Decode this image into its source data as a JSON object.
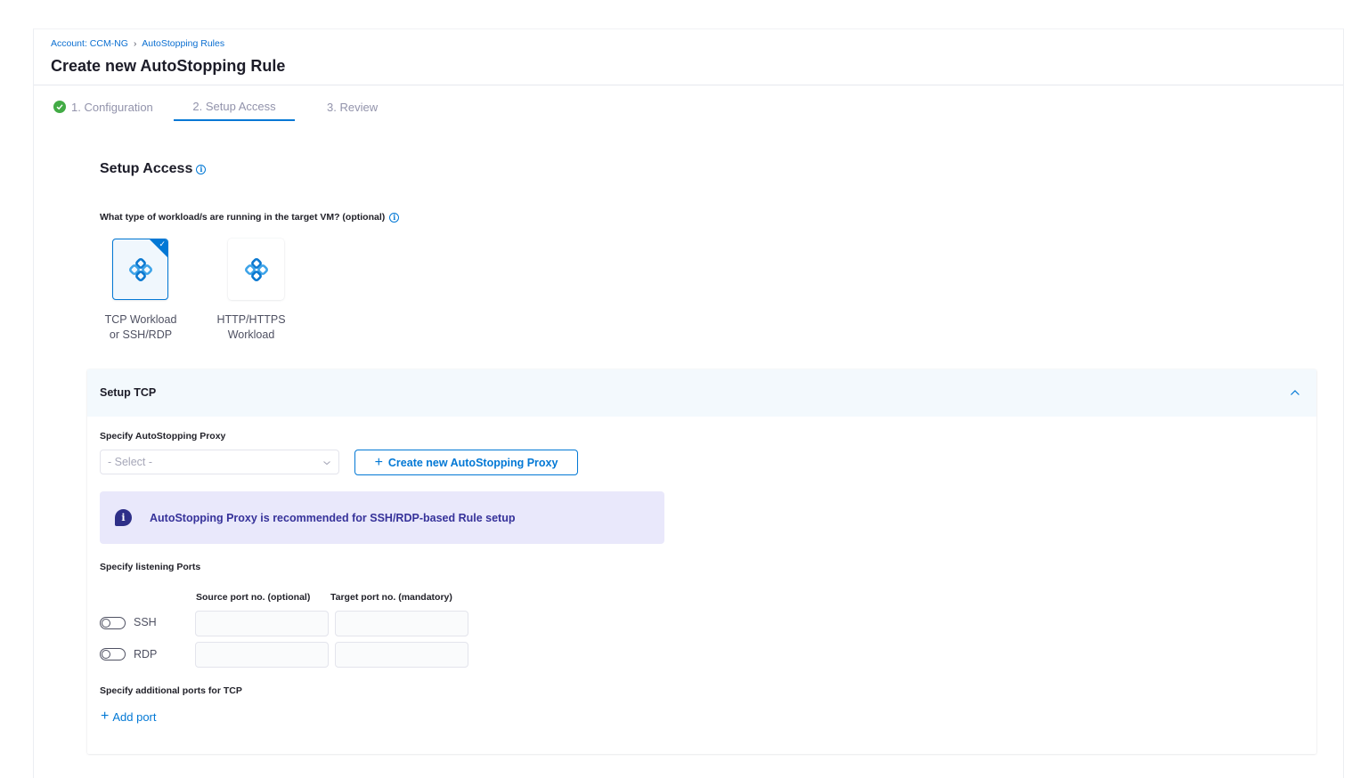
{
  "breadcrumb": {
    "account": "Account: CCM-NG",
    "separator": "›",
    "rules": "AutoStopping Rules"
  },
  "page_title": "Create new AutoStopping Rule",
  "tabs": [
    {
      "label": "1. Configuration",
      "completed": true
    },
    {
      "label": "2. Setup Access",
      "active": true
    },
    {
      "label": "3. Review"
    }
  ],
  "setup_access": {
    "title": "Setup Access",
    "question": "What type of workload/s are running in the target VM? (optional)",
    "workloads": [
      {
        "label_line1": "TCP Workload",
        "label_line2": "or SSH/RDP",
        "selected": true
      },
      {
        "label_line1": "HTTP/HTTPS",
        "label_line2": "Workload",
        "selected": false
      }
    ]
  },
  "tcp_panel": {
    "title": "Setup TCP",
    "proxy_label": "Specify AutoStopping Proxy",
    "select_placeholder": "- Select -",
    "create_proxy_label": "Create new AutoStopping Proxy",
    "callout": "AutoStopping Proxy is recommended for SSH/RDP-based Rule setup",
    "ports_label": "Specify listening Ports",
    "source_header": "Source port no. (optional)",
    "target_header": "Target port no. (mandatory)",
    "rows": [
      {
        "label": "SSH",
        "enabled": false,
        "source": "",
        "target": ""
      },
      {
        "label": "RDP",
        "enabled": false,
        "source": "",
        "target": ""
      }
    ],
    "additional_label": "Specify additional ports for TCP",
    "add_port_label": "Add port"
  },
  "colors": {
    "accent": "#0278d5",
    "success": "#42ab45",
    "callout_bg": "#e9e8fb",
    "callout_text": "#36329a"
  }
}
